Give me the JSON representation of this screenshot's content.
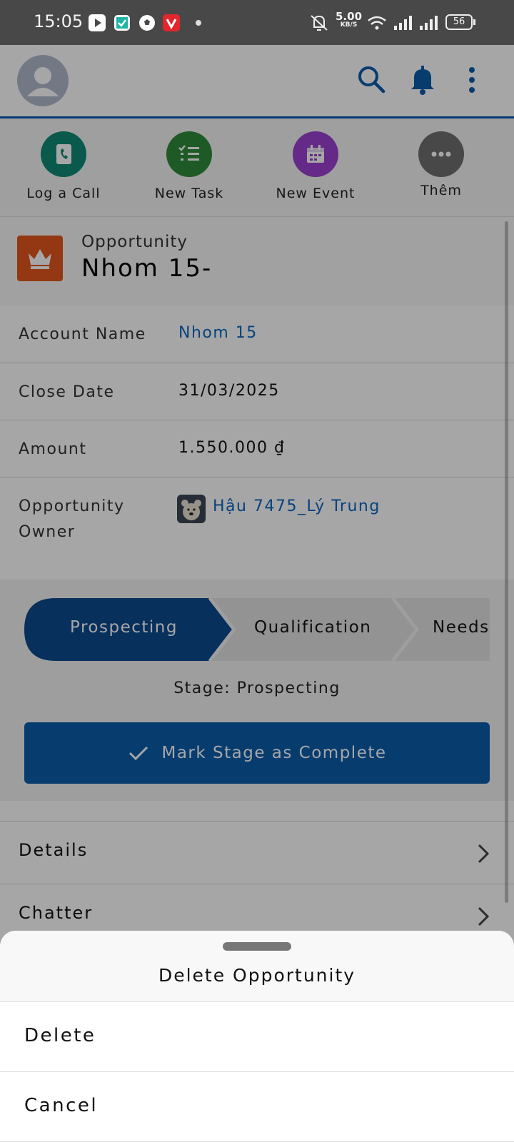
{
  "status_bar": {
    "time": "15:05",
    "net_speed_value": "5.00",
    "net_speed_unit": "KB/S",
    "battery": "56"
  },
  "header": {
    "icons": [
      "avatar",
      "search-icon",
      "bell-icon",
      "more-vert-icon"
    ]
  },
  "quick_actions": [
    {
      "label": "Log a Call",
      "color": "#0f8a76",
      "icon": "phone-book-icon"
    },
    {
      "label": "New Task",
      "color": "#2e8b3a",
      "icon": "checklist-icon"
    },
    {
      "label": "New Event",
      "color": "#9b3fd0",
      "icon": "calendar-icon"
    },
    {
      "label": "Thêm",
      "color": "#6f6f6f",
      "icon": "more-horiz-icon"
    }
  ],
  "record": {
    "type": "Opportunity",
    "name": "Nhom 15-",
    "icon_color": "#e2561c"
  },
  "fields": {
    "account_name": {
      "label": "Account Name",
      "value": "Nhom 15"
    },
    "close_date": {
      "label": "Close Date",
      "value": "31/03/2025"
    },
    "amount": {
      "label": "Amount",
      "value": "1.550.000 ₫"
    },
    "owner": {
      "label_line1": "Opportunity",
      "label_line2": "Owner",
      "value": "Hậu 7475_Lý Trung"
    }
  },
  "path": {
    "stages": [
      "Prospecting",
      "Qualification",
      "Needs"
    ],
    "active_index": 0,
    "stage_text": "Stage: Prospecting",
    "mark_button": "Mark Stage as Complete",
    "active_color": "#0b4a8f"
  },
  "nav": {
    "details": "Details",
    "chatter": "Chatter"
  },
  "sheet": {
    "title": "Delete Opportunity",
    "delete": "Delete",
    "cancel": "Cancel"
  }
}
